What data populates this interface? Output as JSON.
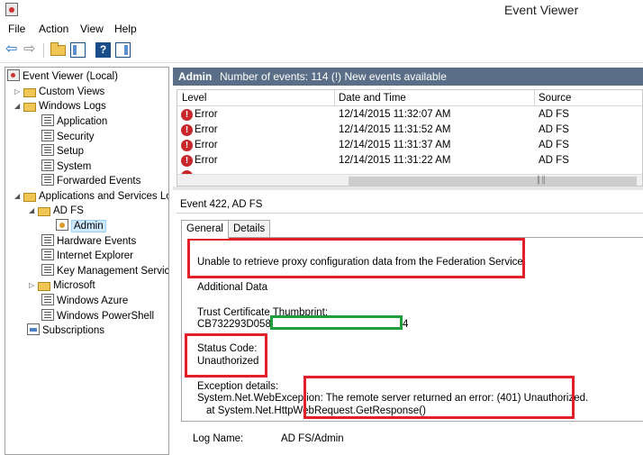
{
  "window": {
    "title": "Event Viewer"
  },
  "menu": {
    "items": [
      "File",
      "Action",
      "View",
      "Help"
    ]
  },
  "tree": {
    "items": [
      {
        "label": "Event Viewer (Local)",
        "icon": "event-viewer-icon",
        "expander": ""
      },
      {
        "label": "Custom Views",
        "icon": "folder-icon",
        "expander": "▷"
      },
      {
        "label": "Windows Logs",
        "icon": "folder-icon",
        "expander": "◢"
      },
      {
        "label": "Application",
        "icon": "log-icon",
        "expander": ""
      },
      {
        "label": "Security",
        "icon": "log-icon",
        "expander": ""
      },
      {
        "label": "Setup",
        "icon": "log-icon",
        "expander": ""
      },
      {
        "label": "System",
        "icon": "log-icon",
        "expander": ""
      },
      {
        "label": "Forwarded Events",
        "icon": "log-icon",
        "expander": ""
      },
      {
        "label": "Applications and Services Lo",
        "icon": "folder-icon",
        "expander": "◢"
      },
      {
        "label": "AD FS",
        "icon": "folder-icon",
        "expander": "◢"
      },
      {
        "label": "Admin",
        "icon": "admin-log-icon",
        "expander": ""
      },
      {
        "label": "Hardware Events",
        "icon": "log-icon",
        "expander": ""
      },
      {
        "label": "Internet Explorer",
        "icon": "log-icon",
        "expander": ""
      },
      {
        "label": "Key Management Service",
        "icon": "log-icon",
        "expander": ""
      },
      {
        "label": "Microsoft",
        "icon": "folder-icon",
        "expander": "▷"
      },
      {
        "label": "Windows Azure",
        "icon": "log-icon",
        "expander": ""
      },
      {
        "label": "Windows PowerShell",
        "icon": "log-icon",
        "expander": ""
      },
      {
        "label": "Subscriptions",
        "icon": "subscriptions-icon",
        "expander": ""
      }
    ]
  },
  "header": {
    "title": "Admin",
    "count": "Number of events: 114 (!) New events available"
  },
  "events": {
    "columns": [
      "Level",
      "Date and Time",
      "Source"
    ],
    "rows": [
      {
        "level": "Error",
        "datetime": "12/14/2015 11:32:07 AM",
        "source": "AD FS"
      },
      {
        "level": "Error",
        "datetime": "12/14/2015 11:31:52 AM",
        "source": "AD FS"
      },
      {
        "level": "Error",
        "datetime": "12/14/2015 11:31:37 AM",
        "source": "AD FS"
      },
      {
        "level": "Error",
        "datetime": "12/14/2015 11:31:22 AM",
        "source": "AD FS"
      }
    ]
  },
  "detail": {
    "title": "Event 422, AD FS",
    "tabs": [
      "General",
      "Details"
    ],
    "message": "Unable to retrieve proxy configuration data from the Federation Service.",
    "additional": "Additional Data",
    "thumb_label": "Trust Certificate Thumbprint:",
    "thumb_value": "CB732293D058EE",
    "thumb_tail": "4",
    "status_label": "Status Code:",
    "status_value": "Unauthorized",
    "exception_label": "Exception details:",
    "exception_line1": "System.Net.WebException: The remote server returned an error: (401) Unauthorized.",
    "exception_line2": "at System.Net.HttpWebRequest.GetResponse()",
    "log_name_label": "Log Name:",
    "log_name_value": "AD FS/Admin"
  }
}
